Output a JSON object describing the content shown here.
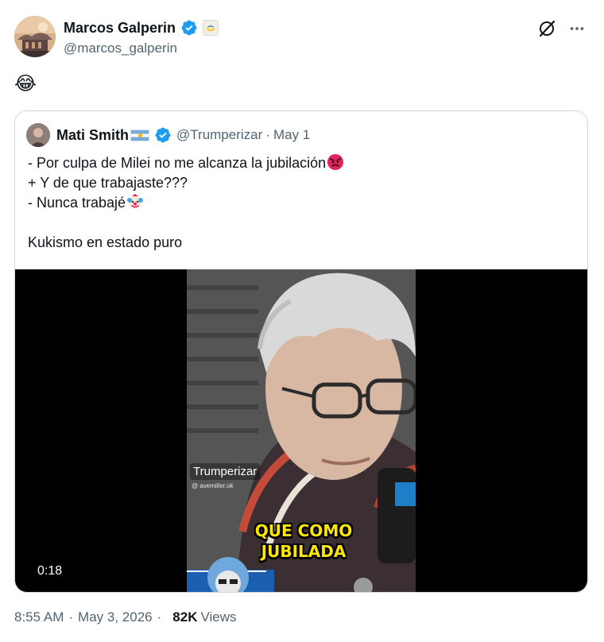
{
  "tweet": {
    "author": {
      "display_name": "Marcos Galperin",
      "handle": "@marcos_galperin"
    },
    "text": "😂",
    "quoted": {
      "author": {
        "display_name": "Mati Smith",
        "handle": "@Trumperizar",
        "date": "May 1"
      },
      "separator": "·",
      "lines": [
        "- Por culpa de Milei no me alcanza la jubilación",
        "+ Y de que trabajaste???",
        "- Nunca trabajé",
        "",
        "Kukismo en estado puro"
      ],
      "video": {
        "duration": "0:18",
        "watermark": "Trumperizar",
        "watermark_sub": "@ avemiller.ok",
        "caption_line1": "QUE COMO",
        "caption_line2": "JUBILADA"
      }
    },
    "meta": {
      "time": "8:55 AM",
      "separator": "·",
      "date": "May 3, 2026",
      "views_count": "82K",
      "views_label": "Views"
    }
  },
  "colors": {
    "text_primary": "#0f1419",
    "text_secondary": "#536471",
    "verified_blue": "#1d9bf0",
    "border": "#cfd9de",
    "caption_yellow": "#ffe600"
  },
  "icons": {
    "verified": "verified-badge-icon",
    "affiliate": "affiliate-badge-icon",
    "grok": "grok-icon",
    "more": "more-horizontal-icon"
  }
}
